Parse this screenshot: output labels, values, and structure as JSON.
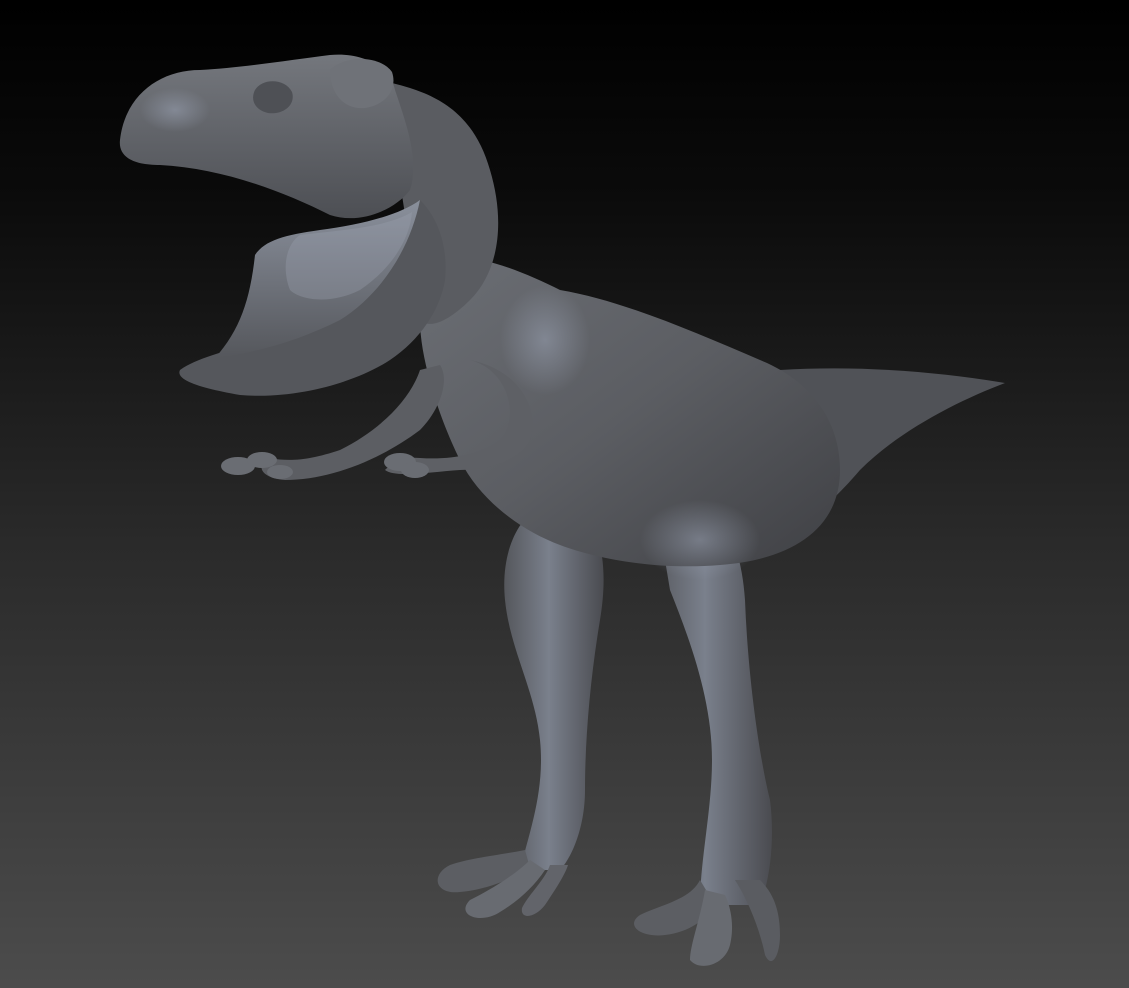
{
  "scene": {
    "subject_icon": "dinosaur-model-icon",
    "background_colors": [
      "#000000",
      "#2a2a2a",
      "#4c4c4c"
    ],
    "model_color": "#5f6166",
    "highlight_color": "#8c93a3",
    "shadow_color": "#2e2f33"
  }
}
